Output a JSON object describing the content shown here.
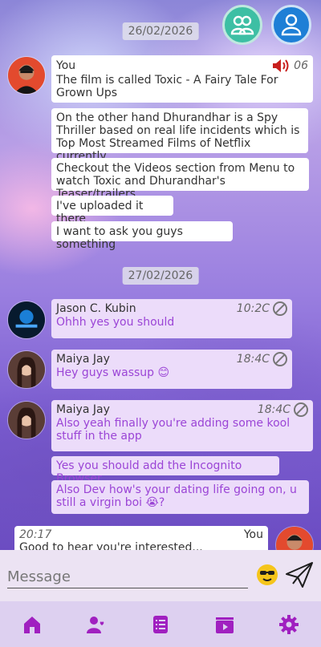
{
  "header": {
    "group_button_icon": "group-icon",
    "profile_button_icon": "user-icon"
  },
  "dates": [
    "26/02/2026",
    "27/02/2026"
  ],
  "messages": [
    {
      "sender": "You",
      "time": "06",
      "texts": [
        "The film is called Toxic - A Fairy Tale For Grown Ups",
        "On the other hand Dhurandhar is a Spy Thriller based on real life incidents which is Top Most Streamed Films of Netflix currently",
        "Checkout the Videos section from Menu to watch Toxic and Dhurandhar's Teaser/trailers",
        "I've uploaded it there",
        "I want to ask you guys something"
      ]
    },
    {
      "sender": "Jason C. Kubin",
      "time": "10:2C",
      "texts": [
        "Ohhh yes you should"
      ]
    },
    {
      "sender": "Maiya Jay",
      "time": "18:4C",
      "texts": [
        "Hey guys wassup 😊"
      ]
    },
    {
      "sender": "Maiya Jay",
      "time": "18:4C",
      "texts": [
        "Also yeah finally you're adding some kool stuff in the app",
        "Yes you should add the Incognito Browser",
        "Also Dev how's your dating life going on, u still a virgin boi 😭?"
      ]
    },
    {
      "sender": "You",
      "time": "20:17",
      "texts": [
        "Good to hear you're interested..."
      ]
    }
  ],
  "composer": {
    "placeholder": "Message",
    "emoji_icon": "sunglasses-emoji-icon",
    "send_icon": "paper-plane-icon"
  },
  "nav": {
    "items": [
      "home-icon",
      "friends-icon",
      "notes-icon",
      "videos-icon",
      "settings-icon"
    ]
  },
  "colors": {
    "accent": "#a020c0",
    "bubble_other": "#ecdcfa",
    "purple_text": "#9b45d6"
  }
}
